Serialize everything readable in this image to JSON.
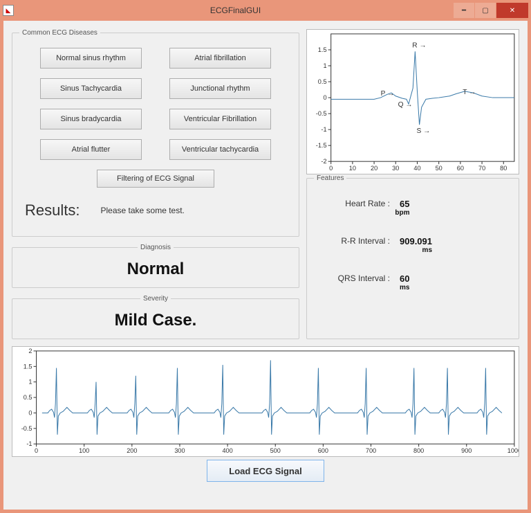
{
  "window": {
    "title": "ECGFinalGUI",
    "icon_glyph": "◣"
  },
  "diseases": {
    "legend": "Common ECG Diseases",
    "buttons": [
      "Normal sinus rhythm",
      "Atrial fibrillation",
      "Sinus Tachycardia",
      "Junctional rhythm",
      "Sinus bradycardia",
      "Ventricular Fibrillation",
      "Atrial flutter",
      "Ventricular tachycardia"
    ],
    "filter_button": "Filtering of ECG Signal"
  },
  "results": {
    "label": "Results:",
    "text": "Please take some test."
  },
  "diagnosis": {
    "legend": "Diagnosis",
    "value": "Normal"
  },
  "severity": {
    "legend": "Severity",
    "value": "Mild Case."
  },
  "features": {
    "legend": "Features",
    "heart_rate_label": "Heart Rate :",
    "heart_rate_value": "65",
    "heart_rate_unit": "bpm",
    "rr_label": "R-R Interval :",
    "rr_value": "909.091",
    "rr_unit": "ms",
    "qrs_label": "QRS Interval :",
    "qrs_value": "60",
    "qrs_unit": "ms"
  },
  "load_button": "Load ECG Signal",
  "chart_data": [
    {
      "type": "line",
      "title": "",
      "xlabel": "",
      "ylabel": "",
      "xlim": [
        0,
        85
      ],
      "ylim": [
        -2,
        2
      ],
      "xticks": [
        0,
        10,
        20,
        30,
        40,
        50,
        60,
        70,
        80
      ],
      "yticks": [
        -2,
        -1.5,
        -1,
        -0.5,
        0,
        0.5,
        1,
        1.5
      ],
      "annotations": [
        {
          "label": "P",
          "x": 27,
          "y": 0.15
        },
        {
          "label": "Q",
          "x": 35,
          "y": -0.2
        },
        {
          "label": "R",
          "x": 39,
          "y": 1.45
        },
        {
          "label": "S",
          "x": 41,
          "y": -0.85
        },
        {
          "label": "T",
          "x": 65,
          "y": 0.2
        }
      ],
      "series": [
        {
          "name": "beat",
          "x_values": [
            0,
            5,
            10,
            15,
            20,
            23,
            26,
            28,
            30,
            33,
            35,
            36,
            38,
            39,
            40,
            41,
            42,
            44,
            47,
            50,
            55,
            58,
            62,
            66,
            70,
            75,
            80,
            85
          ],
          "y_values": [
            -0.05,
            -0.05,
            -0.05,
            -0.05,
            -0.05,
            0.0,
            0.1,
            0.15,
            0.05,
            -0.02,
            -0.05,
            -0.2,
            0.3,
            1.45,
            0.2,
            -0.85,
            -0.3,
            -0.05,
            -0.02,
            0.0,
            0.05,
            0.12,
            0.2,
            0.15,
            0.05,
            0.0,
            0.0,
            0.0
          ]
        }
      ]
    },
    {
      "type": "line",
      "title": "",
      "xlabel": "",
      "ylabel": "",
      "xlim": [
        0,
        1000
      ],
      "ylim": [
        -1,
        2
      ],
      "xticks": [
        0,
        100,
        200,
        300,
        400,
        500,
        600,
        700,
        800,
        900,
        1000
      ],
      "yticks": [
        -1,
        -0.5,
        0,
        0.5,
        1,
        1.5,
        2
      ],
      "series": [
        {
          "name": "ecg",
          "beat_centers": [
            42,
            125,
            208,
            295,
            390,
            490,
            590,
            690,
            790,
            860,
            940
          ],
          "beat_peaks": [
            1.45,
            1.0,
            1.2,
            1.45,
            1.55,
            1.7,
            1.45,
            1.45,
            1.45,
            1.45,
            1.45
          ],
          "beat_template_x": [
            -30,
            -18,
            -14,
            -10,
            -6,
            -4,
            -2,
            0,
            2,
            4,
            8,
            14,
            22,
            28,
            34
          ],
          "beat_template_y": [
            0.0,
            0.0,
            0.08,
            0.12,
            0.02,
            -0.15,
            0.3,
            1.0,
            -0.7,
            -0.1,
            0.0,
            0.05,
            0.18,
            0.08,
            0.0
          ]
        }
      ]
    }
  ]
}
